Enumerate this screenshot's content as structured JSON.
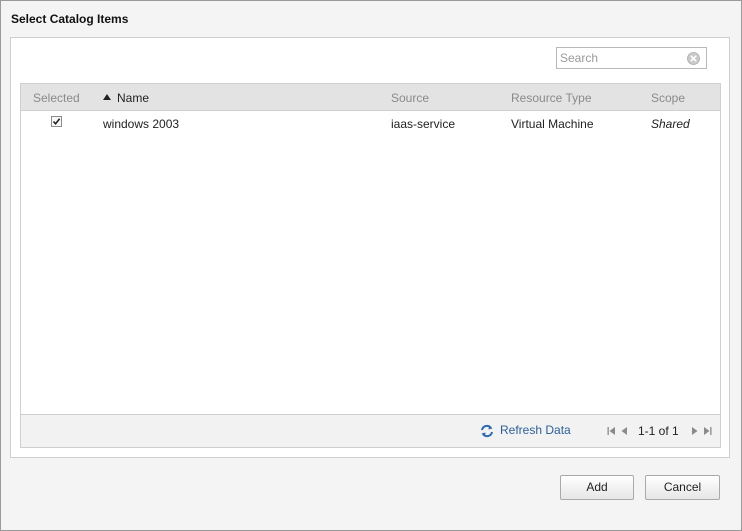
{
  "dialog": {
    "title": "Select Catalog Items"
  },
  "search": {
    "placeholder": "Search",
    "value": ""
  },
  "grid": {
    "columns": {
      "selected": "Selected",
      "name": "Name",
      "source": "Source",
      "resource_type": "Resource Type",
      "scope": "Scope"
    },
    "sort": {
      "column": "name",
      "direction": "ascending"
    },
    "rows": [
      {
        "selected": true,
        "name": "windows 2003",
        "source": "iaas-service",
        "resource_type": "Virtual Machine",
        "scope": "Shared"
      }
    ]
  },
  "footer": {
    "refresh_label": "Refresh Data",
    "page_info": "1-1 of 1"
  },
  "buttons": {
    "add": "Add",
    "cancel": "Cancel"
  },
  "icons": {
    "clear": "clear-icon",
    "sort": "sort-ascending-icon",
    "refresh": "refresh-icon",
    "first": "first-page-icon",
    "prev": "previous-page-icon",
    "next": "next-page-icon",
    "last": "last-page-icon"
  },
  "colors": {
    "link": "#2b5f9a",
    "header_bg": "#e3e3e3",
    "dialog_bg": "#f4f4f4"
  }
}
